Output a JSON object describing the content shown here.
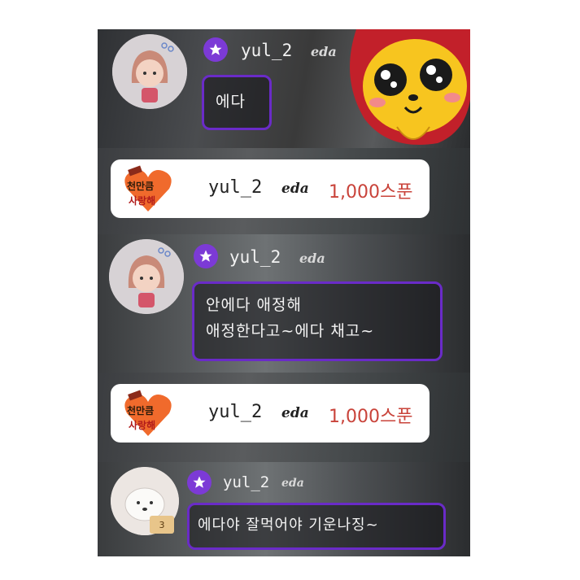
{
  "chat": [
    {
      "type": "message",
      "username": "yul_2",
      "tag": "eda",
      "lines": [
        "에다"
      ]
    },
    {
      "type": "donation",
      "username": "yul_2",
      "tag": "eda",
      "amount": "1,000스푼",
      "badge_text": [
        "천만큼",
        "사랑해"
      ]
    },
    {
      "type": "message",
      "username": "yul_2",
      "tag": "eda",
      "lines": [
        "안에다 애정해",
        "애정한다고~에다 채고~"
      ]
    },
    {
      "type": "donation",
      "username": "yul_2",
      "tag": "eda",
      "amount": "1,000스푼",
      "badge_text": [
        "천만큼",
        "사랑해"
      ]
    },
    {
      "type": "message",
      "username": "yul_2",
      "tag": "eda",
      "lines": [
        "에다야 잘먹어야 기운나징~"
      ],
      "level_badge": "3"
    }
  ],
  "colors": {
    "accent_purple": "#7c3ad6",
    "bubble_border": "#6a2bc8",
    "donation_amount": "#c9433a"
  }
}
